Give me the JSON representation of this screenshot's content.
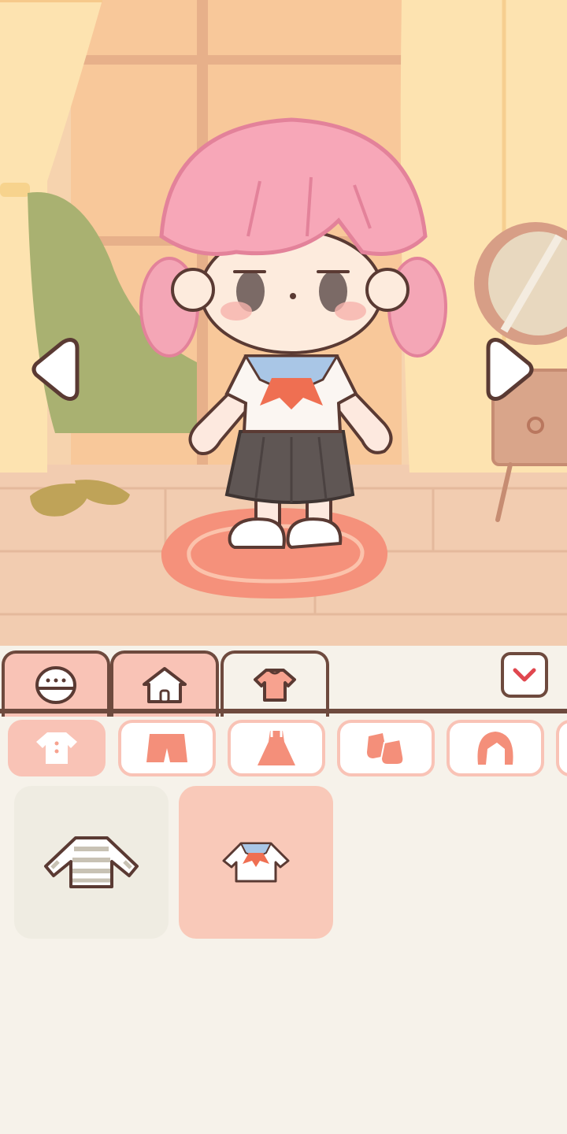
{
  "colors": {
    "outline": "#6e4a3e",
    "accent": "#f0806a",
    "tab_inactive": "#f9c3b6",
    "tab_active": "#f6f2ea",
    "panel_bg": "#f6f2ea",
    "item_plain": "#efece2",
    "item_selected": "#f9c9b9"
  },
  "scene": {
    "nav_left_icon": "triangle-left-icon",
    "nav_right_icon": "triangle-right-icon"
  },
  "tabs": [
    {
      "icon": "face-icon",
      "active": false
    },
    {
      "icon": "house-icon",
      "active": false
    },
    {
      "icon": "shirt-icon",
      "active": true
    }
  ],
  "dropdown_icon": "chevron-down-icon",
  "categories": [
    {
      "icon": "tshirt-icon",
      "active": true
    },
    {
      "icon": "shorts-icon",
      "active": false
    },
    {
      "icon": "dress-icon",
      "active": false
    },
    {
      "icon": "socks-icon",
      "active": false
    },
    {
      "icon": "hair-icon",
      "active": false
    }
  ],
  "items": [
    {
      "icon": "striped-shirt-icon",
      "selected": false
    },
    {
      "icon": "sailor-top-icon",
      "selected": true
    }
  ]
}
